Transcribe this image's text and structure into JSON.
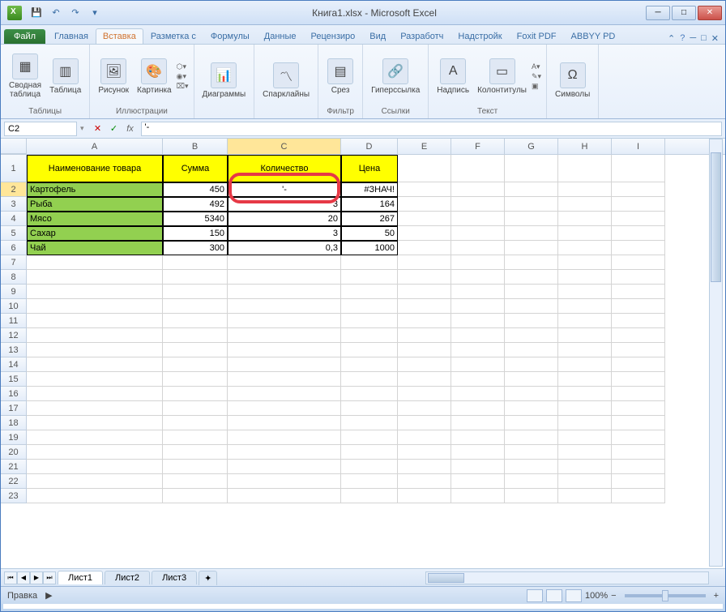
{
  "window": {
    "title": "Книга1.xlsx - Microsoft Excel"
  },
  "tabs": {
    "file": "Файл",
    "t0": "Главная",
    "t1": "Вставка",
    "t2": "Разметка с",
    "t3": "Формулы",
    "t4": "Данные",
    "t5": "Рецензиро",
    "t6": "Вид",
    "t7": "Разработч",
    "t8": "Надстройк",
    "t9": "Foxit PDF",
    "t10": "ABBYY PD"
  },
  "ribbon": {
    "g0": {
      "label": "Таблицы",
      "b0": "Сводная\nтаблица",
      "b1": "Таблица"
    },
    "g1": {
      "label": "Иллюстрации",
      "b0": "Рисунок",
      "b1": "Картинка"
    },
    "g2": {
      "label": "",
      "b0": "Диаграммы"
    },
    "g3": {
      "label": "",
      "b0": "Спарклайны"
    },
    "g4": {
      "label": "Фильтр",
      "b0": "Срез"
    },
    "g5": {
      "label": "Ссылки",
      "b0": "Гиперссылка"
    },
    "g6": {
      "label": "Текст",
      "b0": "Надпись",
      "b1": "Колонтитулы"
    },
    "g7": {
      "label": "",
      "b0": "Символы"
    }
  },
  "namebox": "C2",
  "formula": "'-",
  "cols": {
    "A": "A",
    "B": "B",
    "C": "C",
    "D": "D",
    "E": "E",
    "F": "F",
    "G": "G",
    "H": "H",
    "I": "I"
  },
  "headers": {
    "A": "Наименование товара",
    "B": "Сумма",
    "C": "Количество",
    "D": "Цена"
  },
  "data": [
    {
      "A": "Картофель",
      "B": "450",
      "C": "'-",
      "D": "#ЗНАЧ!"
    },
    {
      "A": "Рыба",
      "B": "492",
      "C": "3",
      "D": "164"
    },
    {
      "A": "Мясо",
      "B": "5340",
      "C": "20",
      "D": "267"
    },
    {
      "A": "Сахар",
      "B": "150",
      "C": "3",
      "D": "50"
    },
    {
      "A": "Чай",
      "B": "300",
      "C": "0,3",
      "D": "1000"
    }
  ],
  "sheets": {
    "s1": "Лист1",
    "s2": "Лист2",
    "s3": "Лист3"
  },
  "status": {
    "mode": "Правка",
    "zoom": "100%"
  }
}
